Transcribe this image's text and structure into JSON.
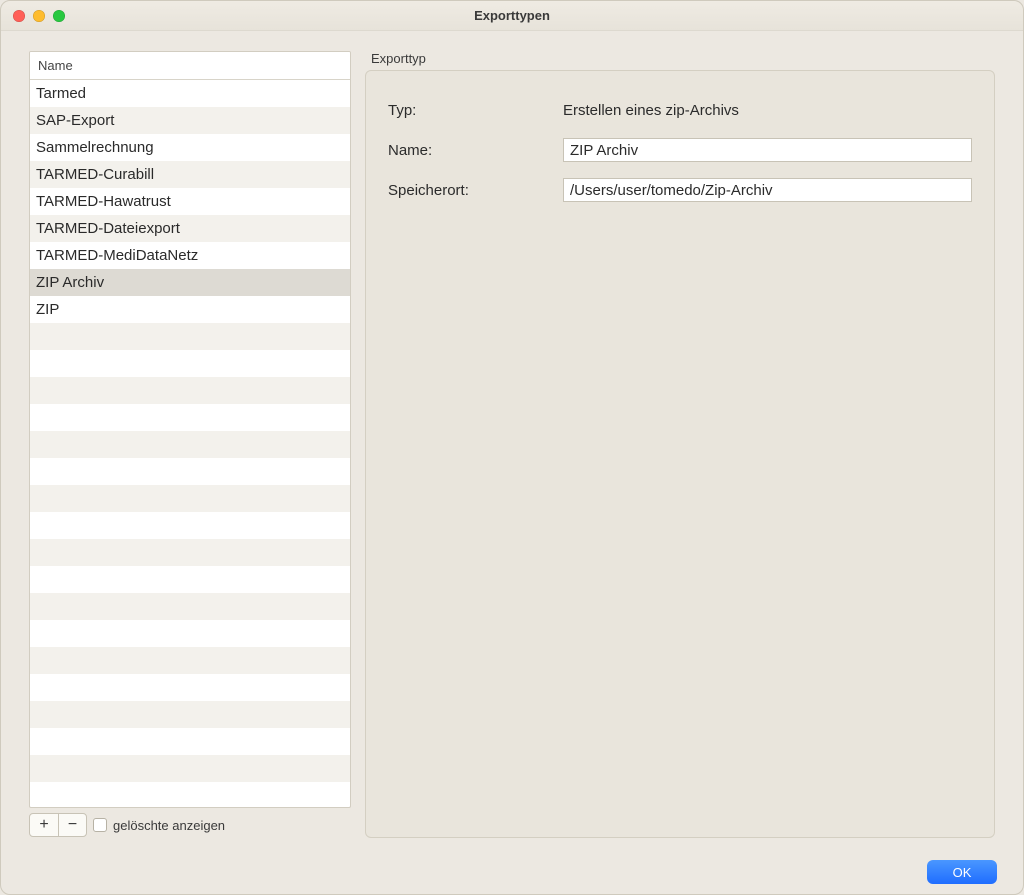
{
  "window": {
    "title": "Exporttypen"
  },
  "table": {
    "header": "Name",
    "items": [
      "Tarmed",
      "SAP-Export",
      "Sammelrechnung",
      "TARMED-Curabill",
      "TARMED-Hawatrust",
      "TARMED-Dateiexport",
      "TARMED-MediDataNetz",
      "ZIP Archiv",
      "ZIP"
    ],
    "selected_index": 7,
    "visible_rows": 27
  },
  "left_toolbar": {
    "add_label": "+",
    "remove_label": "−",
    "show_deleted_label": "gelöschte anzeigen"
  },
  "detail": {
    "group_title": "Exporttyp",
    "typ_label": "Typ:",
    "typ_value": "Erstellen eines zip-Archivs",
    "name_label": "Name:",
    "name_value": "ZIP Archiv",
    "speicherort_label": "Speicherort:",
    "speicherort_value": "/Users/user/tomedo/Zip-Archiv"
  },
  "footer": {
    "ok_label": "OK"
  }
}
